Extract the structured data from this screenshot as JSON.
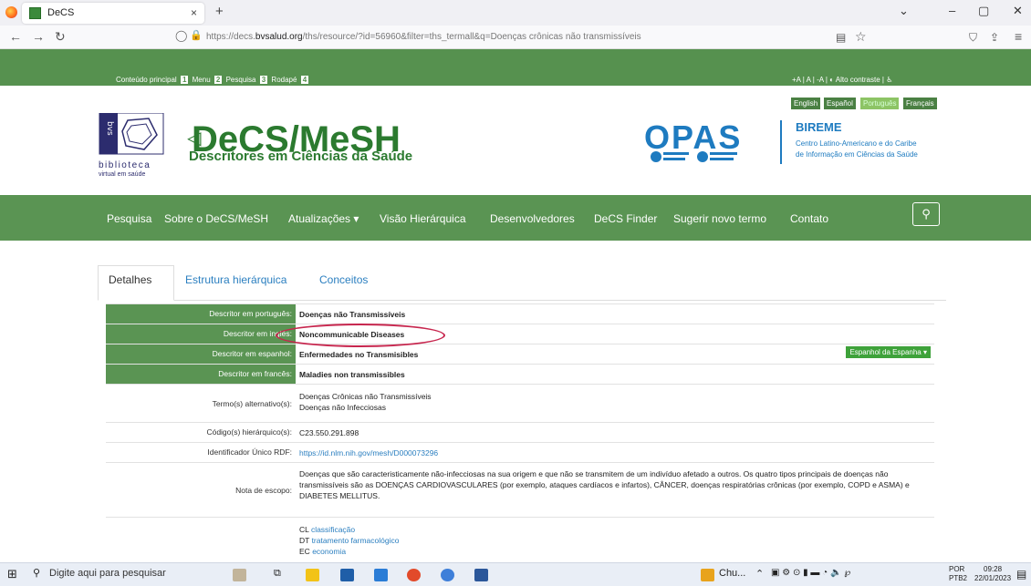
{
  "browser": {
    "tab_title": "DeCS",
    "tab_close": "×",
    "new_tab": "+",
    "url_prefix": "https://decs.",
    "url_domain": "bvsalud.org",
    "url_rest": "/ths/resource/?id=56960&filter=ths_termall&q=Doenças crônicas não transmissíveis",
    "win_min": "–",
    "win_max": "▢",
    "win_close": "✕",
    "menu_chevron": "⌄"
  },
  "accessibility": {
    "items": [
      "Conteúdo principal",
      "Menu",
      "Pesquisa",
      "Rodapé"
    ],
    "keys": [
      "1",
      "2",
      "3",
      "4"
    ],
    "right": "+A | A | -A | ◐ Alto contraste | ♿"
  },
  "languages": [
    "English",
    "Español",
    "Português",
    "Français"
  ],
  "logo": {
    "bvs_text": "biblioteca",
    "bvs_sub": "virtual em saúde",
    "title": "DeCS/MeSH",
    "subtitle": "Descritores em Ciências da Saúde",
    "opas": "OPAS",
    "bireme": "BIREME",
    "bireme_sub1": "Centro Latino-Americano e do Caribe",
    "bireme_sub2": "de Informação em Ciências da Saúde"
  },
  "menu": [
    "Pesquisa",
    "Sobre o DeCS/MeSH",
    "Atualizações ▾",
    "Visão Hierárquica",
    "Desenvolvedores",
    "DeCS Finder",
    "Sugerir novo termo",
    "Contato"
  ],
  "tabs": [
    "Detalhes",
    "Estrutura hierárquica",
    "Conceitos"
  ],
  "rows": [
    {
      "label": "Descritor em português:",
      "value": "Doenças não Transmissíveis"
    },
    {
      "label": "Descritor em inglês:",
      "value": "Noncommunicable Diseases"
    },
    {
      "label": "Descritor em espanhol:",
      "value": "Enfermedades no Transmisibles",
      "button": "Espanhol da Espanha ▾"
    },
    {
      "label": "Descritor em francês:",
      "value": "Maladies non transmissibles"
    },
    {
      "label": "Termo(s) alternativo(s):",
      "value1": "Doenças Crônicas não Transmissíveis",
      "value2": "Doenças não Infecciosas"
    },
    {
      "label": "Código(s) hierárquico(s):",
      "value": "C23.550.291.898"
    },
    {
      "label": "Identificador Único RDF:",
      "value": "https://id.nlm.nih.gov/mesh/D000073296"
    },
    {
      "label": "Nota de escopo:",
      "value": "Doenças que são caracteristicamente não-infecciosas na sua origem e que não se transmitem de um indivíduo afetado a outros. Os quatro tipos principais de doenças não transmissíveis são as DOENÇAS CARDIOVASCULARES (por exemplo, ataques cardíacos e infartos), CÂNCER, doenças respiratórias crônicas (por exemplo, COPD e ASMA) e DIABETES MELLITUS."
    },
    {
      "label": "",
      "q1_code": "CL",
      "q1": "classificação",
      "q2_code": "DT",
      "q2": "tratamento farmacológico",
      "q3_code": "EC",
      "q3": "economia"
    }
  ],
  "taskbar": {
    "search_placeholder": "Digite aqui para pesquisar",
    "chrome_label": "Chu...",
    "lang1": "POR",
    "lang2": "PTB2",
    "time": "09:28",
    "date": "22/01/2023"
  },
  "colors": {
    "green": "#5a9453",
    "dark_green": "#2b7a2f",
    "blue": "#1e7bc0",
    "highlight": "#c7264e"
  }
}
